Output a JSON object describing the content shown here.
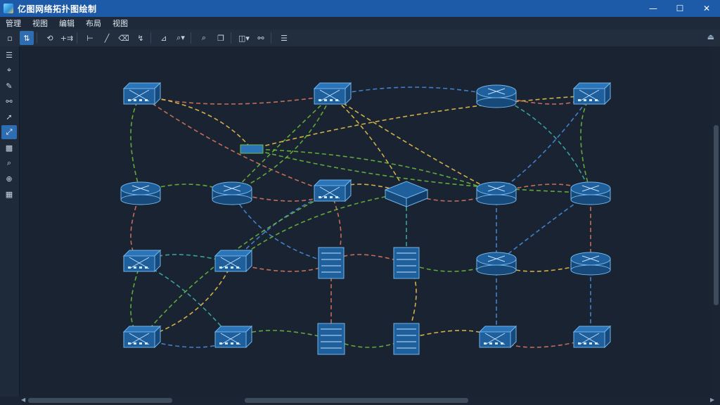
{
  "window": {
    "title": "亿图网络拓扑图绘制"
  },
  "window_controls": {
    "minimize": "—",
    "maximize": "☐",
    "close": "✕"
  },
  "menu": [
    {
      "label": "管理"
    },
    {
      "label": "视图"
    },
    {
      "label": "编辑"
    },
    {
      "label": "布局"
    },
    {
      "label": "视图"
    }
  ],
  "toolbar": {
    "buttons": [
      {
        "name": "toolbar-rect-button",
        "glyph": "▫"
      },
      {
        "name": "toolbar-layout-button",
        "glyph": "⇅"
      },
      {
        "name": "toolbar-lasso-button",
        "glyph": "⟲"
      },
      {
        "name": "toolbar-plus-button",
        "glyph": "+⇉"
      },
      {
        "name": "toolbar-connector-button",
        "glyph": "⊢"
      },
      {
        "name": "toolbar-line-button",
        "glyph": "╱"
      },
      {
        "name": "toolbar-eraser-button",
        "glyph": "⌫"
      },
      {
        "name": "toolbar-curve-button",
        "glyph": "↯"
      },
      {
        "name": "toolbar-shape-button",
        "glyph": "⊿"
      },
      {
        "name": "toolbar-zoom-button",
        "glyph": "⌕▾"
      },
      {
        "name": "toolbar-search-button",
        "glyph": "⌕"
      },
      {
        "name": "toolbar-copy-button",
        "glyph": "❐"
      },
      {
        "name": "toolbar-view-button",
        "glyph": "◫▾"
      },
      {
        "name": "toolbar-link-button",
        "glyph": "⚯"
      },
      {
        "name": "toolbar-list-button",
        "glyph": "☰"
      }
    ],
    "collapse": "⏏"
  },
  "sidebar": {
    "items": [
      {
        "name": "sidebar-menu-icon",
        "glyph": "☰"
      },
      {
        "name": "sidebar-pointer-icon",
        "glyph": "⌖"
      },
      {
        "name": "sidebar-pen-icon",
        "glyph": "✎"
      },
      {
        "name": "sidebar-link-icon",
        "glyph": "⚯"
      },
      {
        "name": "sidebar-arrow-icon",
        "glyph": "➚"
      },
      {
        "name": "sidebar-connector-icon",
        "glyph": "⤢"
      },
      {
        "name": "sidebar-box-icon",
        "glyph": "▩"
      },
      {
        "name": "sidebar-search-icon",
        "glyph": "⌕"
      },
      {
        "name": "sidebar-zoom-icon",
        "glyph": "⊕"
      },
      {
        "name": "sidebar-panel-icon",
        "glyph": "▦"
      }
    ]
  },
  "scroll": {
    "left": "◀",
    "right": "▶"
  },
  "diagram": {
    "node_fill": "#1f5f9c",
    "node_stroke": "#6fb4ea",
    "colors": [
      "#e07a5f",
      "#f2c94c",
      "#6fbf3d",
      "#4a90e2",
      "#3fb7a8"
    ],
    "nodes": [
      {
        "id": "n1",
        "type": "switch",
        "col": 0,
        "row": 0
      },
      {
        "id": "n2",
        "type": "switch",
        "col": 2,
        "row": 0
      },
      {
        "id": "n3",
        "type": "router",
        "col": 4,
        "row": 0
      },
      {
        "id": "n4",
        "type": "switch",
        "col": 5,
        "row": 0
      },
      {
        "id": "n5",
        "type": "router",
        "col": 0,
        "row": 1
      },
      {
        "id": "n6",
        "type": "router",
        "col": 1,
        "row": 1
      },
      {
        "id": "n7",
        "type": "switch",
        "col": 2,
        "row": 1
      },
      {
        "id": "n8",
        "type": "box",
        "col": 3,
        "row": 1
      },
      {
        "id": "n9",
        "type": "router",
        "col": 4,
        "row": 1
      },
      {
        "id": "n10",
        "type": "router",
        "col": 5,
        "row": 1
      },
      {
        "id": "n11",
        "type": "switch",
        "col": 0,
        "row": 2
      },
      {
        "id": "n12",
        "type": "switch",
        "col": 1,
        "row": 2
      },
      {
        "id": "n13",
        "type": "server",
        "col": 2,
        "row": 2
      },
      {
        "id": "n14",
        "type": "server",
        "col": 3,
        "row": 2
      },
      {
        "id": "n15",
        "type": "router",
        "col": 4,
        "row": 2
      },
      {
        "id": "n16",
        "type": "router",
        "col": 5,
        "row": 2
      },
      {
        "id": "n17",
        "type": "switch",
        "col": 0,
        "row": 3
      },
      {
        "id": "n18",
        "type": "switch",
        "col": 1,
        "row": 3
      },
      {
        "id": "n19",
        "type": "rack",
        "col": 2,
        "row": 3
      },
      {
        "id": "n20",
        "type": "server",
        "col": 3,
        "row": 3
      },
      {
        "id": "n21",
        "type": "switch",
        "col": 4,
        "row": 3
      },
      {
        "id": "n22",
        "type": "switch",
        "col": 5,
        "row": 3
      },
      {
        "id": "hub",
        "type": "hub",
        "col": -1,
        "row": -1
      }
    ],
    "links": [
      [
        "n1",
        "n2",
        0
      ],
      [
        "n2",
        "n3",
        3
      ],
      [
        "n3",
        "n4",
        0
      ],
      [
        "n1",
        "n5",
        2
      ],
      [
        "n1",
        "n7",
        0
      ],
      [
        "n1",
        "hub",
        1
      ],
      [
        "n2",
        "n6",
        2
      ],
      [
        "n2",
        "n8",
        1
      ],
      [
        "n2",
        "n9",
        1
      ],
      [
        "n4",
        "n10",
        2
      ],
      [
        "n4",
        "n9",
        3
      ],
      [
        "n3",
        "n10",
        4
      ],
      [
        "n5",
        "n11",
        0
      ],
      [
        "n5",
        "n6",
        2
      ],
      [
        "n6",
        "n7",
        0
      ],
      [
        "n7",
        "n8",
        1
      ],
      [
        "n8",
        "n9",
        0
      ],
      [
        "n9",
        "n10",
        0
      ],
      [
        "n6",
        "n13",
        3
      ],
      [
        "n7",
        "n12",
        3
      ],
      [
        "n7",
        "n13",
        0
      ],
      [
        "n8",
        "n12",
        2
      ],
      [
        "n10",
        "n16",
        0
      ],
      [
        "n10",
        "n15",
        3
      ],
      [
        "n11",
        "n17",
        2
      ],
      [
        "n11",
        "n18",
        4
      ],
      [
        "n12",
        "n17",
        1
      ],
      [
        "n12",
        "n11",
        4
      ],
      [
        "n13",
        "n19",
        0
      ],
      [
        "n14",
        "n20",
        1
      ],
      [
        "n15",
        "n16",
        1
      ],
      [
        "n16",
        "n22",
        3
      ],
      [
        "n17",
        "n18",
        3
      ],
      [
        "n18",
        "n19",
        2
      ],
      [
        "n19",
        "n20",
        2
      ],
      [
        "n20",
        "n21",
        1
      ],
      [
        "n21",
        "n22",
        0
      ],
      [
        "n21",
        "n9",
        3
      ],
      [
        "n12",
        "n13",
        0
      ],
      [
        "n13",
        "n14",
        0
      ],
      [
        "n14",
        "n15",
        2
      ],
      [
        "hub",
        "n9",
        2
      ],
      [
        "hub",
        "n10",
        2
      ],
      [
        "hub",
        "n4",
        1
      ],
      [
        "n6",
        "n2",
        2
      ],
      [
        "n17",
        "n7",
        2
      ],
      [
        "n8",
        "n14",
        4
      ]
    ]
  }
}
